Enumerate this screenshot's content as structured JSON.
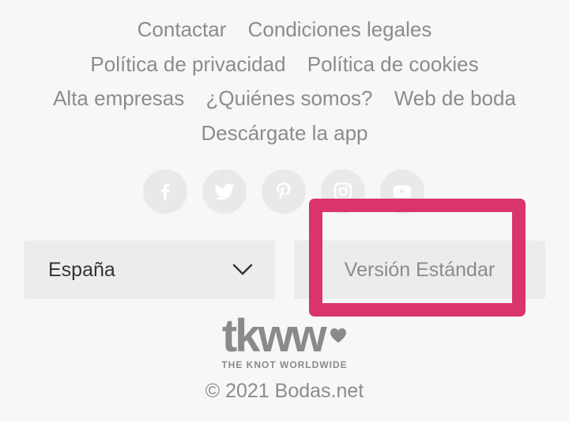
{
  "footer_links": {
    "row1": [
      "Contactar",
      "Condiciones legales"
    ],
    "row2": [
      "Política de privacidad",
      "Política de cookies"
    ],
    "row3": [
      "Alta empresas",
      "¿Quiénes somos?",
      "Web de boda"
    ],
    "row4": [
      "Descárgate la app"
    ]
  },
  "social_icons": [
    "facebook-icon",
    "twitter-icon",
    "pinterest-icon",
    "instagram-icon",
    "youtube-icon"
  ],
  "country_select": {
    "selected": "España"
  },
  "version_button": {
    "label": "Versión Estándar"
  },
  "brand": {
    "logo_text": "tkww",
    "tagline": "THE KNOT WORLDWIDE"
  },
  "copyright": "© 2021 Bodas.net",
  "colors": {
    "background": "#f7f7f7",
    "link_text": "#8c8c8c",
    "highlight": "#d9346e",
    "button_bg": "#ececec",
    "social_bg": "#e9e9e9"
  }
}
